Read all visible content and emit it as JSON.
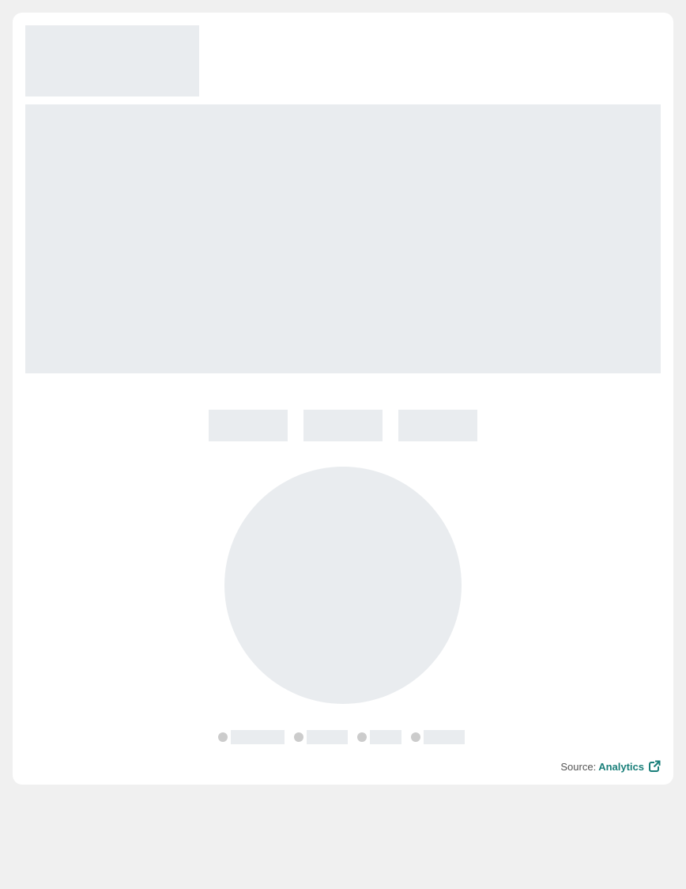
{
  "source": {
    "label": "Source:",
    "link_text": "Analytics",
    "link_icon": "external-link-icon"
  },
  "colors": {
    "page_background": "#f0f0f0",
    "card_background": "#ffffff",
    "skeleton": "#e9ecef",
    "legend_dot": "#cccccc",
    "accent": "#1a7f7a"
  },
  "placeholders": {
    "filter_buttons": 3,
    "legend_items": 4
  }
}
